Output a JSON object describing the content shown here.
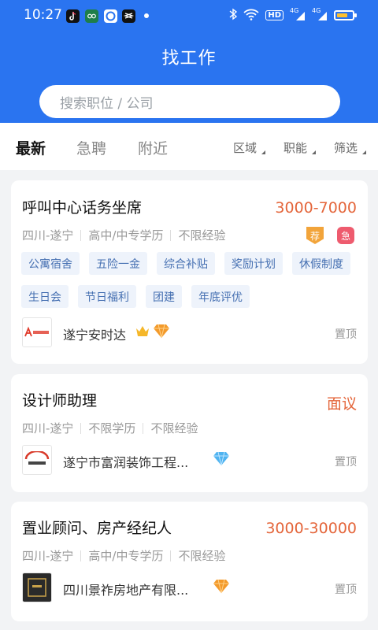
{
  "status_bar": {
    "time": "10:27",
    "apps": [
      "tiktok-icon",
      "oppo-icon",
      "app-icon",
      "capcut-icon"
    ],
    "indicators": [
      "bluetooth-icon",
      "wifi-icon",
      "HD",
      "4G",
      "4G"
    ],
    "hd": "HD",
    "net1": "4G",
    "net2": "4G",
    "battery_level": 0.75
  },
  "header": {
    "title": "找工作",
    "search_placeholder": "搜索职位 / 公司"
  },
  "tabs": [
    {
      "label": "最新",
      "active": true
    },
    {
      "label": "急聘",
      "active": false
    },
    {
      "label": "附近",
      "active": false
    }
  ],
  "filters": [
    {
      "label": "区域"
    },
    {
      "label": "职能"
    },
    {
      "label": "筛选"
    }
  ],
  "jobs": [
    {
      "title": "呼叫中心话务坐席",
      "salary": "3000-7000",
      "location": "四川-遂宁",
      "education": "高中/中专学历",
      "experience": "不限经验",
      "badges": [
        "荐",
        "急"
      ],
      "tags": [
        "公寓宿舍",
        "五险一金",
        "综合补贴",
        "奖励计划",
        "休假制度",
        "生日会",
        "节日福利",
        "团建",
        "年底评优"
      ],
      "company": "遂宁安时达",
      "company_icons": [
        "crown-icon",
        "diamond-icon"
      ],
      "pin": "置顶"
    },
    {
      "title": "设计师助理",
      "salary": "面议",
      "location": "四川-遂宁",
      "education": "不限学历",
      "experience": "不限经验",
      "company": "遂宁市富润装饰工程...",
      "company_icons": [
        "diamond-icon"
      ],
      "pin": "置顶"
    },
    {
      "title": "置业顾问、房产经纪人",
      "salary": "3000-30000",
      "location": "四川-遂宁",
      "education": "高中/中专学历",
      "experience": "不限经验",
      "company": "四川景祚房地产有限...",
      "company_icons": [
        "diamond-icon"
      ],
      "pin": "置顶"
    }
  ],
  "colors": {
    "brand": "#2a74f0",
    "salary": "#e4653a",
    "tag_bg": "#eef3fb",
    "tag_text": "#4670b2"
  }
}
